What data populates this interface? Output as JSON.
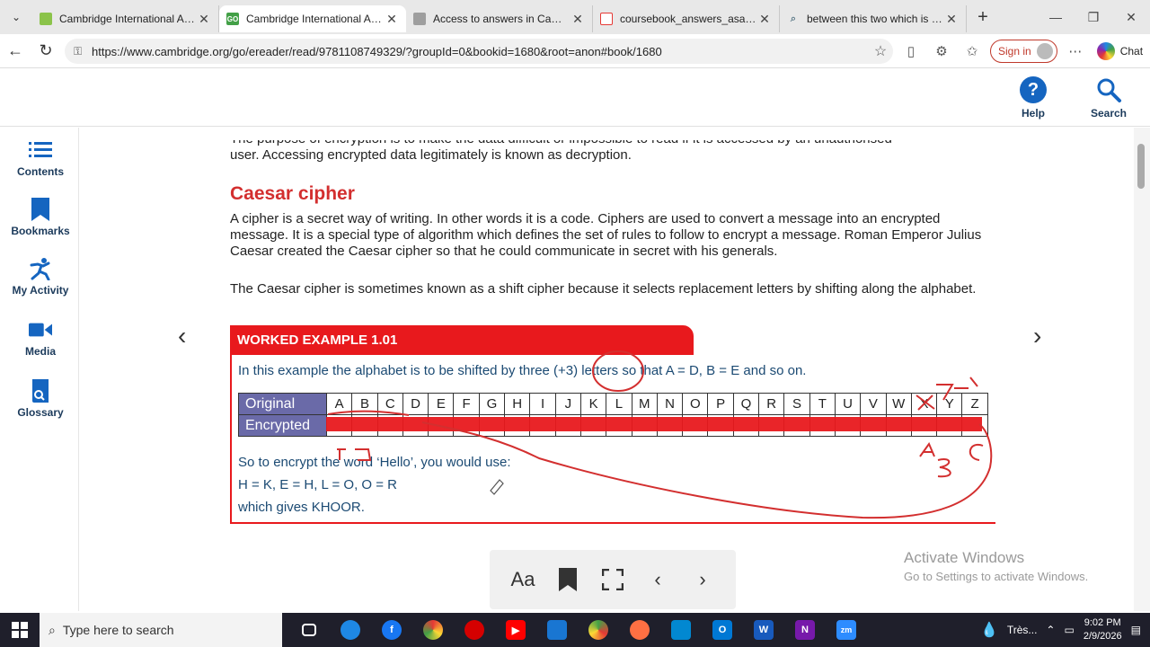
{
  "browser": {
    "tabs": [
      {
        "title": "Cambridge International AS & A",
        "color": "#8bc34a",
        "active": false
      },
      {
        "title": "Cambridge International AS & A",
        "color": "#43a047",
        "active": true
      },
      {
        "title": "Access to answers in Cambridg",
        "color": "#9e9e9e",
        "active": false
      },
      {
        "title": "coursebook_answers_asal_it.pdf",
        "color": "#e53935",
        "active": false
      },
      {
        "title": "between this two which is highe",
        "color": "#90a4ae",
        "active": false
      }
    ],
    "url": "https://www.cambridge.org/go/ereader/read/9781108749329/?groupId=0&bookid=1680&root=anon#book/1680",
    "sign_in": "Sign in",
    "chat": "Chat"
  },
  "header": {
    "help": "Help",
    "search": "Search"
  },
  "sidebar": {
    "items": [
      {
        "label": "Contents",
        "icon": "list-icon"
      },
      {
        "label": "Bookmarks",
        "icon": "bookmark-icon"
      },
      {
        "label": "My Activity",
        "icon": "activity-icon"
      },
      {
        "label": "Media",
        "icon": "video-icon"
      },
      {
        "label": "Glossary",
        "icon": "glossary-icon"
      }
    ]
  },
  "content": {
    "intro_cut": "The purpose of encryption is to make the data difficult or impossible to read if it is accessed by an unauthorised",
    "intro_line": "user. Accessing encrypted data legitimately is known as decryption.",
    "heading": "Caesar cipher",
    "para1": "A cipher is a secret way of writing. In other words it is a code. Ciphers are used to convert a message into an encrypted message. It is a special type of algorithm which defines the set of rules to follow to encrypt a message. Roman Emperor Julius Caesar created the Caesar cipher so that he could communicate in secret with his generals.",
    "para2": "The Caesar cipher is sometimes known as a shift cipher because it selects replacement letters by shifting along the alphabet.",
    "worked_example": {
      "title": "WORKED EXAMPLE 1.01",
      "intro": "In this example the alphabet is to be shifted by three (+3) letters so that A = D, B = E and so on.",
      "row_original": "Original",
      "row_encrypted": "Encrypted",
      "letters": [
        "A",
        "B",
        "C",
        "D",
        "E",
        "F",
        "G",
        "H",
        "I",
        "J",
        "K",
        "L",
        "M",
        "N",
        "O",
        "P",
        "Q",
        "R",
        "S",
        "T",
        "U",
        "V",
        "W",
        "X",
        "Y",
        "Z"
      ],
      "line1": "So to encrypt the word ‘Hello’, you would use:",
      "line2": "H = K, E = H, L = O, O = R",
      "line3": "which gives KHOOR."
    }
  },
  "toolbar": {
    "font_label": "Aa"
  },
  "watermark": {
    "line1": "Activate Windows",
    "line2": "Go to Settings to activate Windows."
  },
  "taskbar": {
    "search_placeholder": "Type here to search",
    "weather": "Très...",
    "time": "9:02 PM",
    "date": "2/9/2026"
  }
}
